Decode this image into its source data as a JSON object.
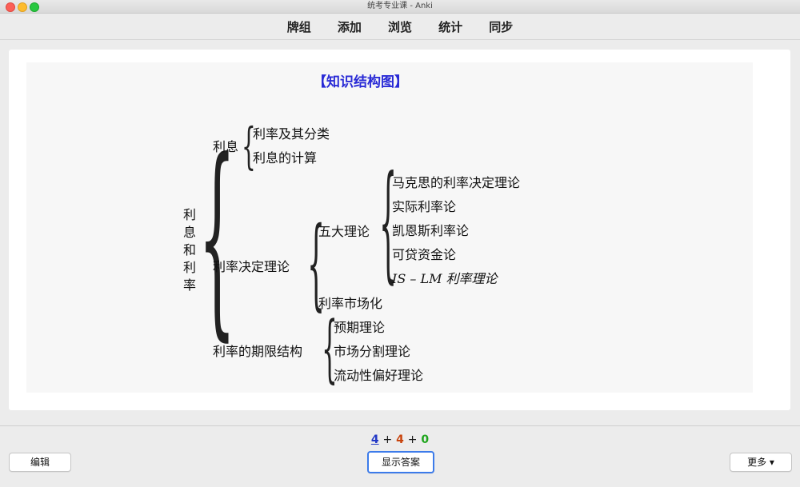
{
  "window": {
    "title": "统考专业课 - Anki"
  },
  "toolbar": {
    "items": [
      "牌组",
      "添加",
      "浏览",
      "统计",
      "同步"
    ]
  },
  "card": {
    "heading": "【知识结构图】",
    "root": "利息和利率",
    "branch1": {
      "label": "利息",
      "children": [
        "利率及其分类",
        "利息的计算"
      ]
    },
    "branch2": {
      "label": "利率决定理论",
      "sub1": {
        "label": "五大理论",
        "children": [
          "马克思的利率决定理论",
          "实际利率论",
          "凯恩斯利率论",
          "可贷资金论",
          "IS – LM 利率理论"
        ]
      },
      "sub2": {
        "label": "利率市场化"
      }
    },
    "branch3": {
      "label": "利率的期限结构",
      "children": [
        "预期理论",
        "市场分割理论",
        "流动性偏好理论"
      ]
    }
  },
  "counts": {
    "new": "4",
    "plus1": "+",
    "learning": "4",
    "plus2": "+",
    "review": "0"
  },
  "buttons": {
    "edit": "编辑",
    "show_answer": "显示答案",
    "more": "更多 ▾"
  }
}
